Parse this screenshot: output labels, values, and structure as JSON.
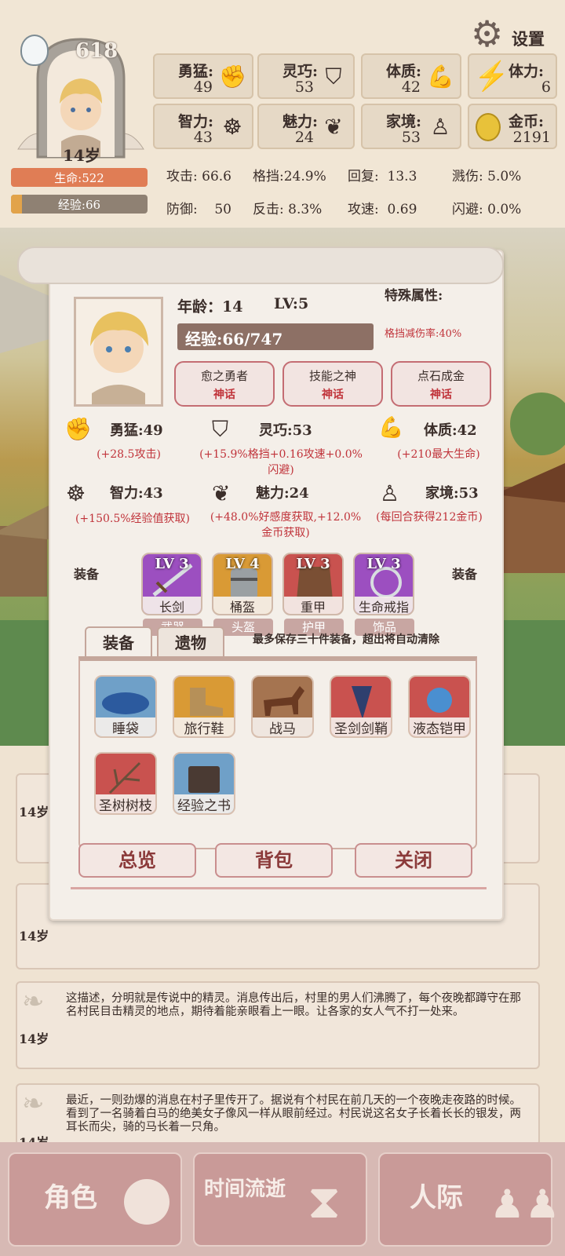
{
  "header": {
    "soul_points": "618",
    "age_tag": "14岁",
    "hp_label": "生命:522",
    "exp_label": "经验:66",
    "settings_label": "设置"
  },
  "attributes": [
    {
      "name": "勇猛:",
      "value": "49",
      "icon": "fist-icon"
    },
    {
      "name": "灵巧:",
      "value": "53",
      "icon": "cloak-icon"
    },
    {
      "name": "体质:",
      "value": "42",
      "icon": "arm-icon"
    },
    {
      "name": "智力:",
      "value": "43",
      "icon": "brain-icon"
    },
    {
      "name": "魅力:",
      "value": "24",
      "icon": "flower-icon"
    },
    {
      "name": "家境:",
      "value": "53",
      "icon": "wealth-icon"
    }
  ],
  "resources": {
    "stamina_label": "体力:",
    "stamina_value": "6",
    "gold_label": "金币:",
    "gold_value": "2191"
  },
  "combat": [
    {
      "label": "攻击:",
      "value": "66.6"
    },
    {
      "label": "格挡:",
      "value": "24.9%"
    },
    {
      "label": "回复:",
      "value": "13.3"
    },
    {
      "label": "溅伤:",
      "value": "5.0%"
    },
    {
      "label": "防御:",
      "value": "50"
    },
    {
      "label": "反击:",
      "value": "8.3%"
    },
    {
      "label": "攻速:",
      "value": "0.69"
    },
    {
      "label": "闪避:",
      "value": "0.0%"
    }
  ],
  "panel": {
    "age_line": "年龄：14",
    "level": "LV:5",
    "exp": "经验:66/747",
    "special_title": "特殊属性:",
    "special_value": "格挡减伤率:40%",
    "titles": [
      {
        "name": "愈之勇者",
        "rank": "神话"
      },
      {
        "name": "技能之神",
        "rank": "神话"
      },
      {
        "name": "点石成金",
        "rank": "神话"
      }
    ],
    "attr_details": [
      {
        "title": "勇猛:49",
        "desc": "(+28.5攻击)"
      },
      {
        "title": "灵巧:53",
        "desc": "(+15.9%格挡+0.16攻速+0.0%闪避)"
      },
      {
        "title": "体质:42",
        "desc": "(+210最大生命)"
      },
      {
        "title": "智力:43",
        "desc": "(+150.5%经验值获取)"
      },
      {
        "title": "魅力:24",
        "desc": "(+48.0%好感度获取,+12.0%金币获取)"
      },
      {
        "title": "家境:53",
        "desc": "(每回合获得212金币)"
      }
    ],
    "equip_left_label": "装备",
    "equip_right_label": "装备",
    "equipment": [
      {
        "level": "LV 3",
        "name": "长剑",
        "type": "武器",
        "color": "#9c4fc0"
      },
      {
        "level": "LV 4",
        "name": "桶盔",
        "type": "头盔",
        "color": "#d99a35"
      },
      {
        "level": "LV 3",
        "name": "重甲",
        "type": "护甲",
        "color": "#c9524f"
      },
      {
        "level": "LV 3",
        "name": "生命戒指",
        "type": "饰品",
        "color": "#9c4fc0"
      }
    ],
    "tabs": [
      "装备",
      "遗物"
    ],
    "notice": "最多保存三十件装备，超出将自动清除",
    "items": [
      {
        "name": "睡袋",
        "color": "#6fa0c8"
      },
      {
        "name": "旅行鞋",
        "color": "#d99a35"
      },
      {
        "name": "战马",
        "color": "#a57450"
      },
      {
        "name": "圣剑剑鞘",
        "color": "#c9524f"
      },
      {
        "name": "液态铠甲",
        "color": "#c9524f"
      },
      {
        "name": "圣树树枝",
        "color": "#c9524f"
      },
      {
        "name": "经验之书",
        "color": "#6fa0c8"
      }
    ],
    "buttons": {
      "overview": "总览",
      "bag": "背包",
      "close": "关闭"
    }
  },
  "logs": [
    {
      "age": "14岁",
      "text": ""
    },
    {
      "age": "14岁",
      "text": ""
    },
    {
      "age": "14岁",
      "text": "这描述，分明就是传说中的精灵。消息传出后，村里的男人们沸腾了，每个夜晚都蹲守在那名村民目击精灵的地点，期待着能亲眼看上一眼。让各家的女人气不打一处来。"
    },
    {
      "age": "14岁",
      "text": "最近，一则劲爆的消息在村子里传开了。据说有个村民在前几天的一个夜晚走夜路的时候。看到了一名骑着白马的绝美女子像风一样从眼前经过。村民说这名女子长着长长的银发，两耳长而尖，骑的马长着一只角。"
    }
  ],
  "nav": {
    "character": "角色",
    "time": "时间流逝",
    "social": "人际"
  }
}
